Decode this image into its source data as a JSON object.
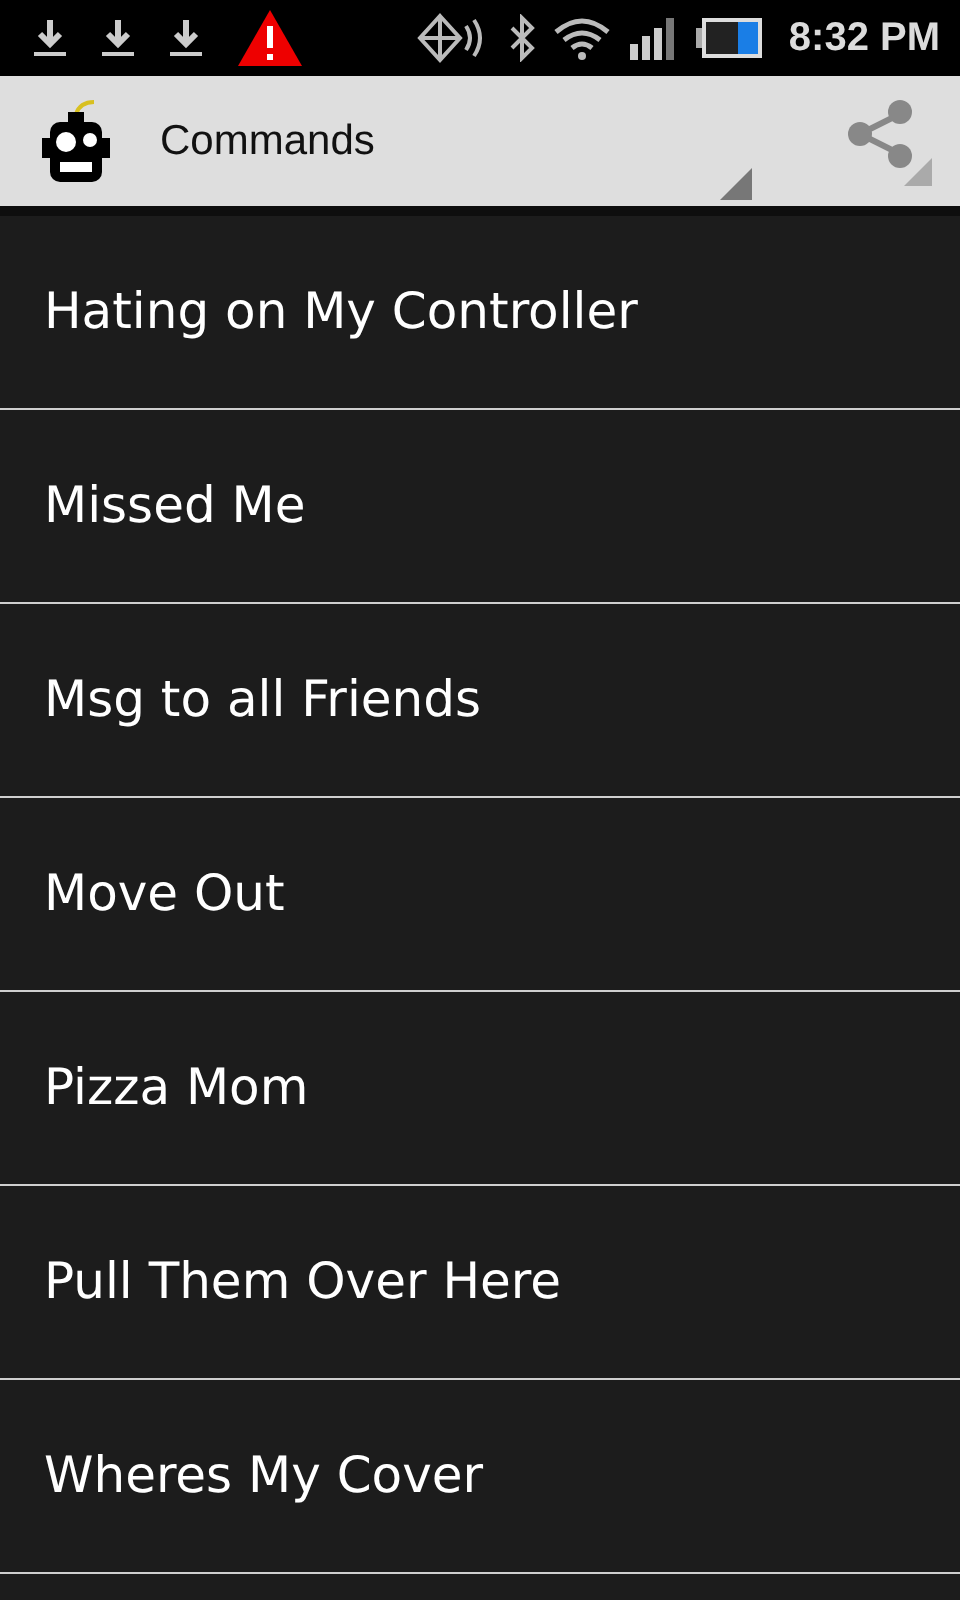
{
  "status_bar": {
    "time": "8:32 PM"
  },
  "action_bar": {
    "title": "Commands"
  },
  "commands": [
    {
      "label": "Hating on My Controller"
    },
    {
      "label": "Missed Me"
    },
    {
      "label": "Msg to all Friends"
    },
    {
      "label": "Move Out"
    },
    {
      "label": "Pizza Mom"
    },
    {
      "label": "Pull Them Over Here"
    },
    {
      "label": "Wheres My Cover"
    }
  ]
}
